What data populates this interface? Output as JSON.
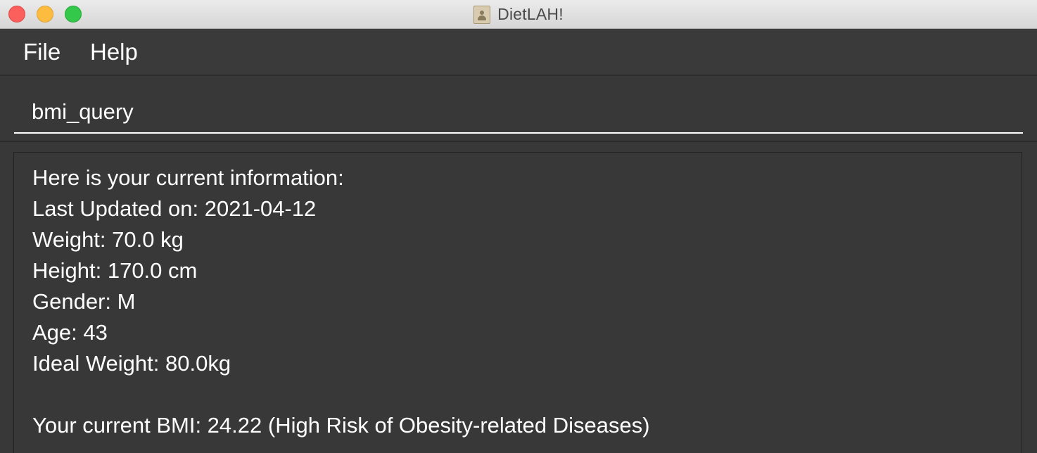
{
  "window": {
    "title": "DietLAH!",
    "app_icon": "address-book-icon"
  },
  "menu": {
    "items": [
      {
        "label": "File"
      },
      {
        "label": "Help"
      }
    ]
  },
  "command": {
    "value": "bmi_query"
  },
  "result": {
    "lines": [
      "Here is your current information:",
      "Last Updated on: 2021-04-12",
      "Weight: 70.0 kg",
      "Height: 170.0 cm",
      "Gender: M",
      "Age: 43",
      "Ideal Weight: 80.0kg",
      "",
      "Your current BMI: 24.22 (High Risk of Obesity-related Diseases)"
    ]
  },
  "colors": {
    "background": "#383838",
    "text": "#ffffff",
    "close": "#fc605c",
    "minimize": "#fdbc40",
    "zoom": "#34c84a"
  }
}
